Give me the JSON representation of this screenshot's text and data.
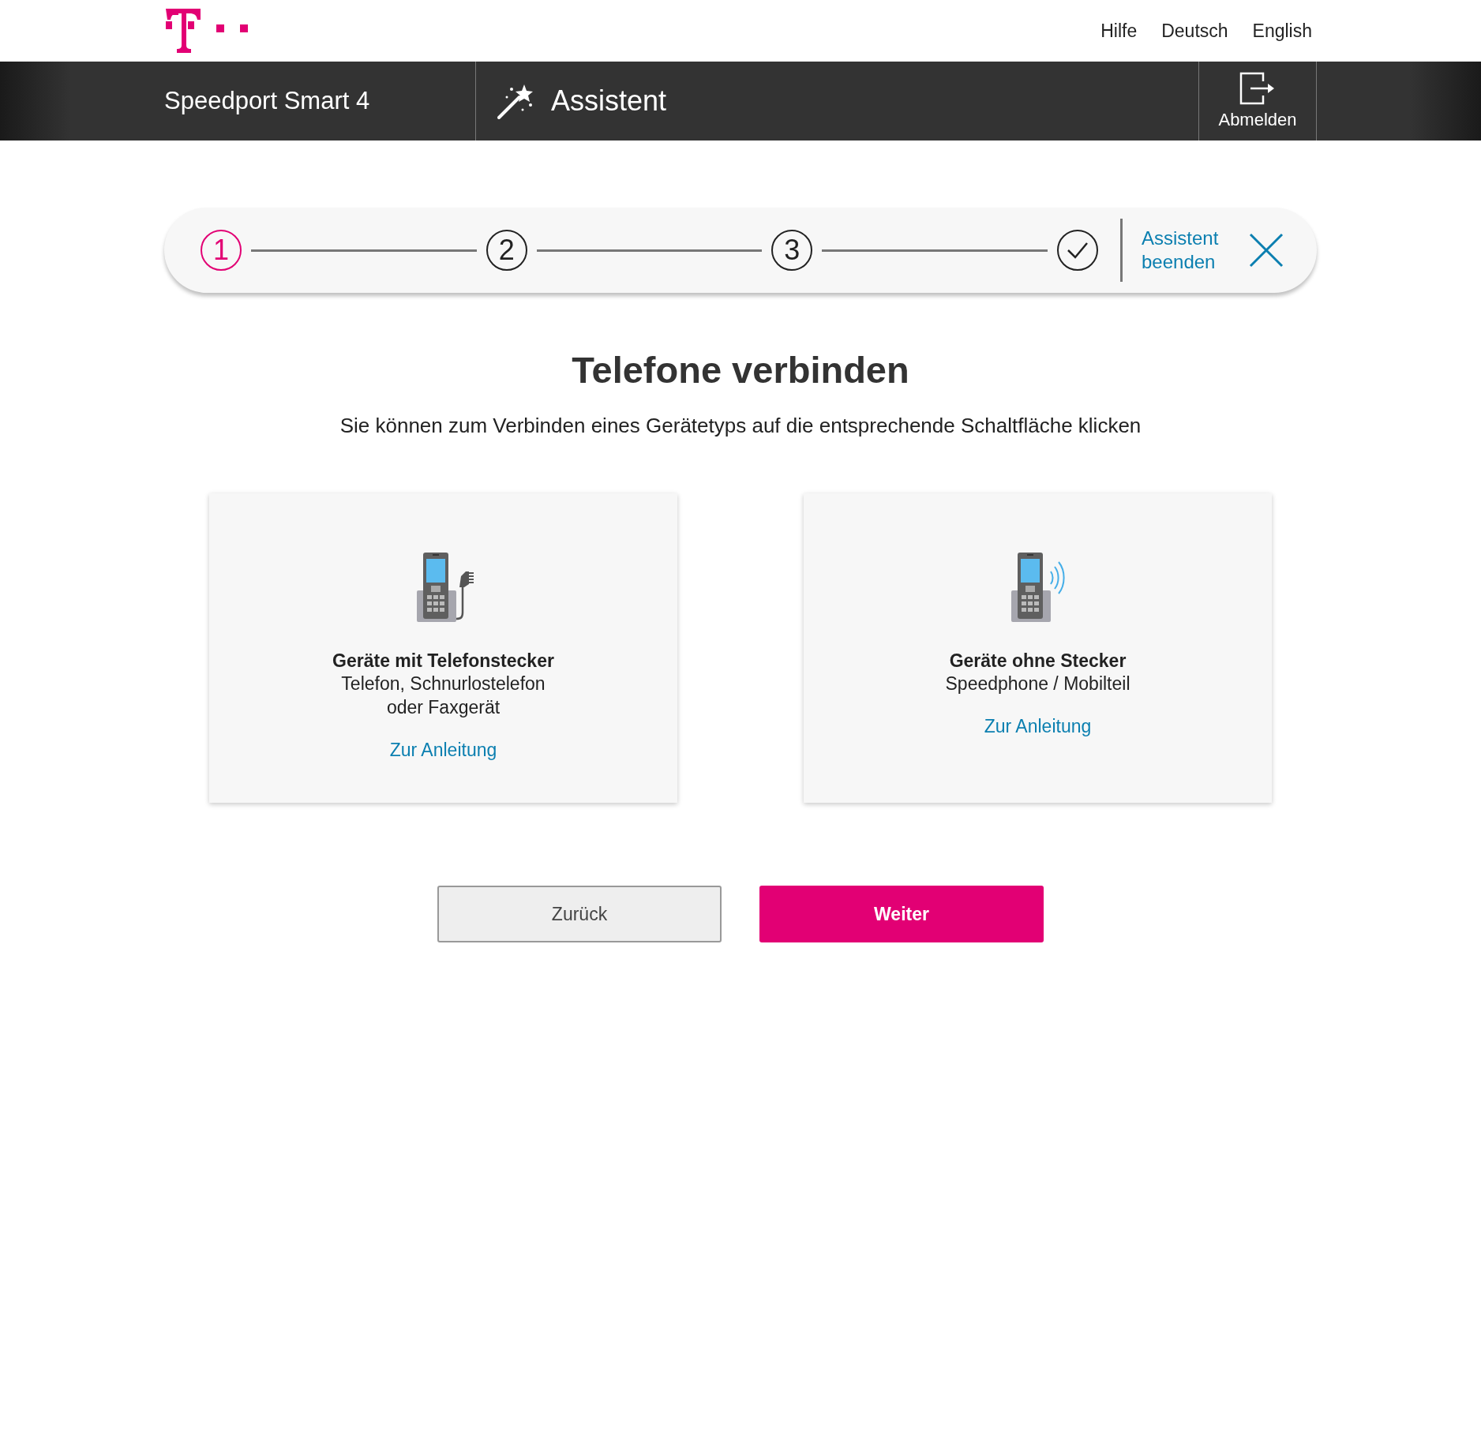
{
  "top_links": [
    "Hilfe",
    "Deutsch",
    "English"
  ],
  "header": {
    "product": "Speedport Smart 4",
    "section": "Assistent",
    "logout": "Abmelden"
  },
  "stepper": {
    "steps": [
      {
        "kind": "number",
        "label": "1",
        "selected": true
      },
      {
        "kind": "number",
        "label": "2",
        "selected": false
      },
      {
        "kind": "number",
        "label": "3",
        "selected": false
      },
      {
        "kind": "done",
        "selected": false
      }
    ],
    "exit_link": "Assistent beenden"
  },
  "title": "Telefone verbinden",
  "subtitle": "Sie können zum Verbinden eines Gerätetyps auf die entsprechende Schaltfläche klicken",
  "cards": [
    {
      "kind": "corded",
      "heading": "Geräte mit Telefonstecker",
      "lines": [
        "Telefon, Schnurlostelefon",
        "oder Faxgerät"
      ],
      "link": "Zur Anleitung"
    },
    {
      "kind": "wireless",
      "heading": "Geräte ohne Stecker",
      "lines": [
        "Speedphone / Mobilteil"
      ],
      "link": "Zur Anleitung"
    }
  ],
  "buttons": {
    "back": "Zurück",
    "next": "Weiter"
  }
}
